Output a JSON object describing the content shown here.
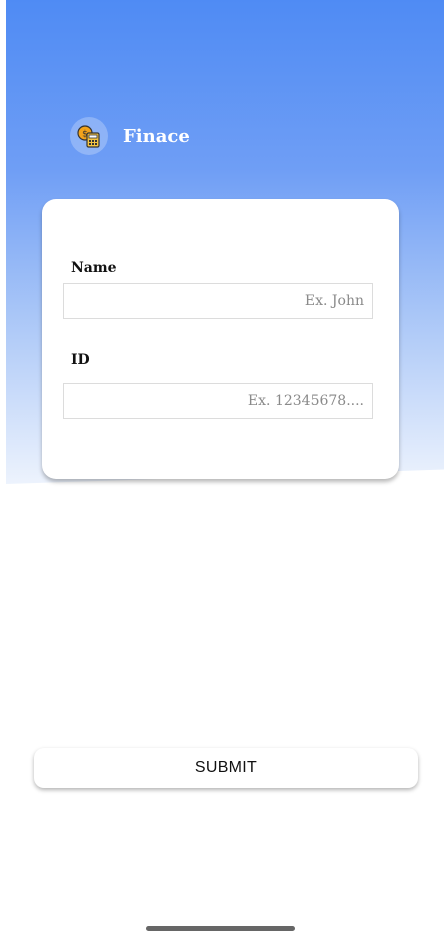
{
  "app": {
    "title": "Finace",
    "logo_icon": "finance-calculator-coin-icon"
  },
  "form": {
    "name_label": "Name",
    "name_placeholder": "Ex. John",
    "id_label": "ID",
    "id_placeholder": "Ex. 12345678...."
  },
  "actions": {
    "submit_label": "SUBMIT"
  },
  "colors": {
    "header_gradient_top": "#4f8bf4",
    "header_gradient_bottom": "#edf3fd",
    "card_background": "#ffffff",
    "field_border": "#dcdcdc"
  }
}
